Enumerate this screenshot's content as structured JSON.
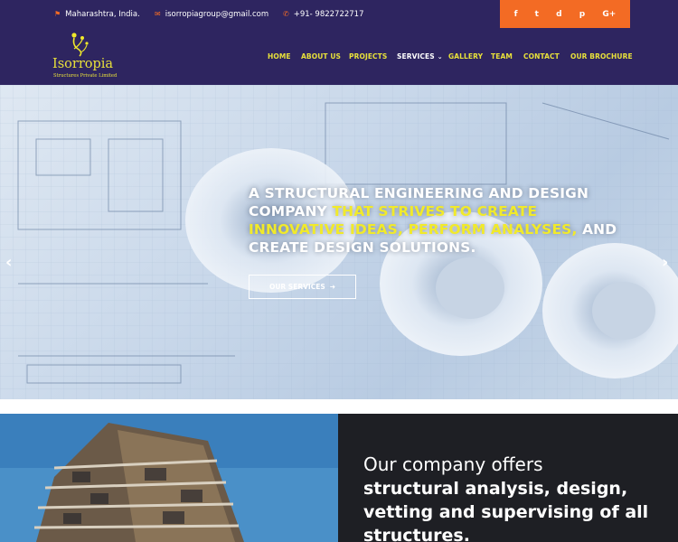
{
  "topbar": {
    "location": "Maharashtra, India.",
    "email": "isorropiagroup@gmail.com",
    "phone": "+91- 9822722717",
    "social": [
      "f",
      "t",
      "d",
      "p",
      "G+"
    ]
  },
  "brand": {
    "name": "Isorropia",
    "tagline": "Structures Private Limited"
  },
  "nav": {
    "items": [
      "HOME",
      "ABOUT US",
      "PROJECTS",
      "SERVICES",
      "GALLERY",
      "TEAM",
      "CONTACT",
      "OUR BROCHURE"
    ]
  },
  "hero": {
    "title_part1": "A STRUCTURAL ENGINEERING AND DESIGN COMPANY ",
    "title_highlight": "THAT STRIVES TO CREATE INNOVATIVE IDEAS, PERFORM ANALYSES,",
    "title_part2": " AND CREATE DESIGN SOLUTIONS.",
    "button": "OUR SERVICES"
  },
  "offer": {
    "light": "Our company offers",
    "bold": "structural analysis, design, vetting and supervising of all structures."
  },
  "colors": {
    "navy": "#2e2560",
    "orange": "#f36b24",
    "yellow": "#f1ea2a",
    "dark": "#1e1f24"
  }
}
